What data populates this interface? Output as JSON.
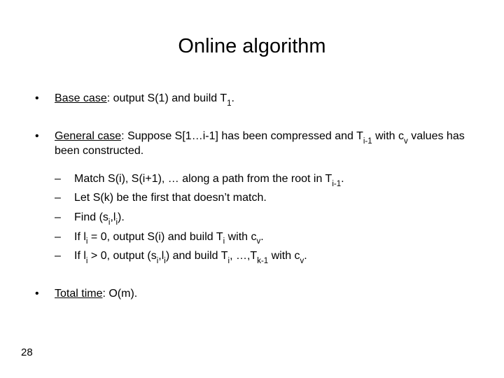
{
  "title": "Online algorithm",
  "bullet_mark": "•",
  "dash_mark": "–",
  "b1": {
    "label": "Base case",
    "rest": ": output S(1) and build T",
    "sub": "1",
    "tail": "."
  },
  "b2": {
    "label": "General case",
    "part1": ": Suppose S[1…i-1] has been compressed and T",
    "sub1": "i-1",
    "part2": " with c",
    "sub2": "v",
    "part3": " values has been constructed."
  },
  "s1": {
    "a": "Match S(i), S(i+1), … along a path from the root in T",
    "sub": "i-1",
    "b": "."
  },
  "s2": {
    "a": "Let S(k) be the first that doesn’t match."
  },
  "s3": {
    "a": "Find (s",
    "sub1": "i",
    "b": ",l",
    "sub2": "i",
    "c": ")."
  },
  "s4": {
    "a": "If l",
    "sub1": "i",
    "b": " = 0, output S(i) and build T",
    "sub2": "i",
    "c": "  with c",
    "sub3": "v",
    "d": "."
  },
  "s5": {
    "a": "If l",
    "sub1": "i",
    "b": " > 0, output (s",
    "sub2": "i",
    "c": ",l",
    "sub3": "i",
    "d": ") and build T",
    "sub4": "i",
    "e": ", …,T",
    "sub5": "k-1",
    "f": " with c",
    "sub6": "v",
    "g": "."
  },
  "b3": {
    "label": "Total time",
    "rest": ": O(m)."
  },
  "page": "28"
}
